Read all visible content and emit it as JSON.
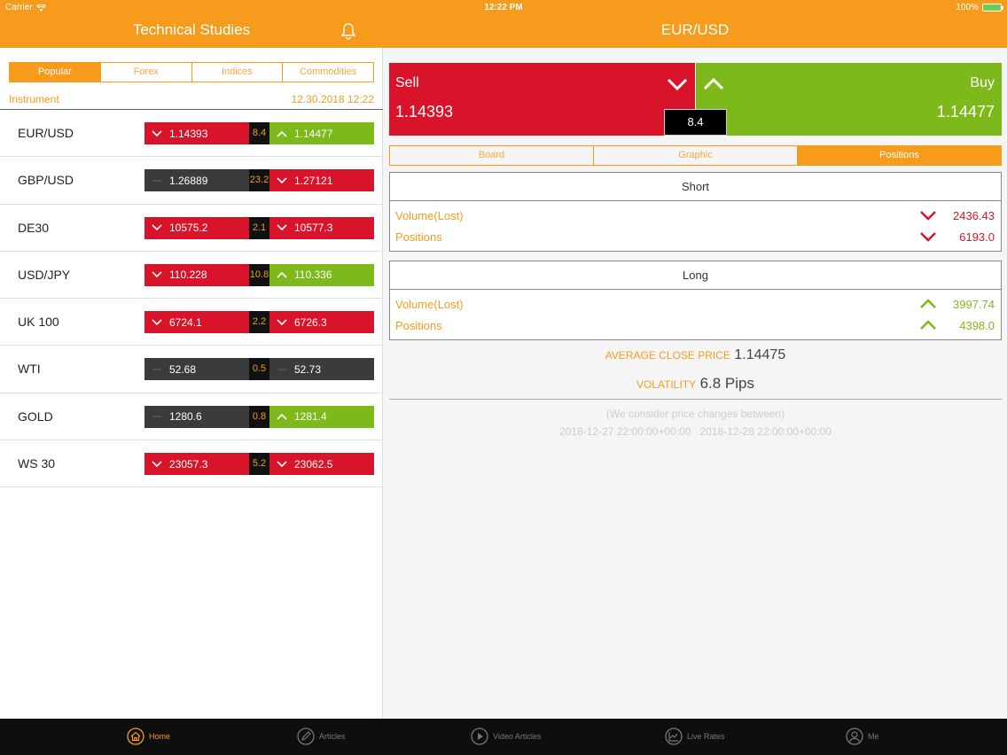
{
  "status": {
    "carrier": "Carrier",
    "time": "12:22 PM",
    "battery": "100%"
  },
  "header": {
    "left_title": "Technical Studies",
    "right_title": "EUR/USD"
  },
  "left_tabs": [
    {
      "label": "Popular",
      "active": true
    },
    {
      "label": "Forex",
      "active": false
    },
    {
      "label": "Indices",
      "active": false
    },
    {
      "label": "Commodities",
      "active": false
    }
  ],
  "instrument_header": {
    "label": "Instrument",
    "timestamp": "12.30.2018 12:22"
  },
  "instruments": [
    {
      "name": "EUR/USD",
      "sell": "1.14393",
      "spread": "8.4",
      "buy": "1.14477",
      "sell_trend": "down",
      "buy_trend": "up"
    },
    {
      "name": "GBP/USD",
      "sell": "1.26889",
      "spread": "23.2",
      "buy": "1.27121",
      "sell_trend": "flat",
      "buy_trend": "down"
    },
    {
      "name": "DE30",
      "sell": "10575.2",
      "spread": "2.1",
      "buy": "10577.3",
      "sell_trend": "down",
      "buy_trend": "down"
    },
    {
      "name": "USD/JPY",
      "sell": "110.228",
      "spread": "10.8",
      "buy": "110.336",
      "sell_trend": "down",
      "buy_trend": "up"
    },
    {
      "name": "UK 100",
      "sell": "6724.1",
      "spread": "2.2",
      "buy": "6726.3",
      "sell_trend": "down",
      "buy_trend": "down"
    },
    {
      "name": "WTI",
      "sell": "52.68",
      "spread": "0.5",
      "buy": "52.73",
      "sell_trend": "flat",
      "buy_trend": "flat"
    },
    {
      "name": "GOLD",
      "sell": "1280.6",
      "spread": "0.8",
      "buy": "1281.4",
      "sell_trend": "flat",
      "buy_trend": "up"
    },
    {
      "name": "WS 30",
      "sell": "23057.3",
      "spread": "5.2",
      "buy": "23062.5",
      "sell_trend": "down",
      "buy_trend": "down"
    }
  ],
  "trade": {
    "sell_label": "Sell",
    "sell_price": "1.14393",
    "buy_label": "Buy",
    "buy_price": "1.14477",
    "spread": "8.4"
  },
  "right_tabs": [
    {
      "label": "Board",
      "active": false
    },
    {
      "label": "Graphic",
      "active": false
    },
    {
      "label": "Positions",
      "active": true
    }
  ],
  "short": {
    "title": "Short",
    "volume_label": "Volume(Lost)",
    "volume": "2436.43",
    "positions_label": "Positions",
    "positions": "6193.0"
  },
  "long": {
    "title": "Long",
    "volume_label": "Volume(Lost)",
    "volume": "3997.74",
    "positions_label": "Positions",
    "positions": "4398.0"
  },
  "avg_close": {
    "label": "AVERAGE CLOSE PRICE",
    "value": "1.14475"
  },
  "volatility": {
    "label": "VOLATILITY",
    "value": "6.8 Pips"
  },
  "note": {
    "line1": "(We consider price changes between)",
    "line2": "2018-12-27 22:00:00+00:00   2018-12-28 22:00:00+00:00"
  },
  "tabbar": [
    {
      "label": "Home",
      "icon": "home-icon",
      "active": true
    },
    {
      "label": "Articles",
      "icon": "pencil-icon",
      "active": false
    },
    {
      "label": "Video Articles",
      "icon": "play-icon",
      "active": false
    },
    {
      "label": "Live Rates",
      "icon": "chart-icon",
      "active": false
    },
    {
      "label": "Me",
      "icon": "user-icon",
      "active": false
    }
  ],
  "colors": {
    "accent": "#f79b1d",
    "down": "#d9142a",
    "up": "#7db91a",
    "neutral": "#3b3b3b"
  }
}
